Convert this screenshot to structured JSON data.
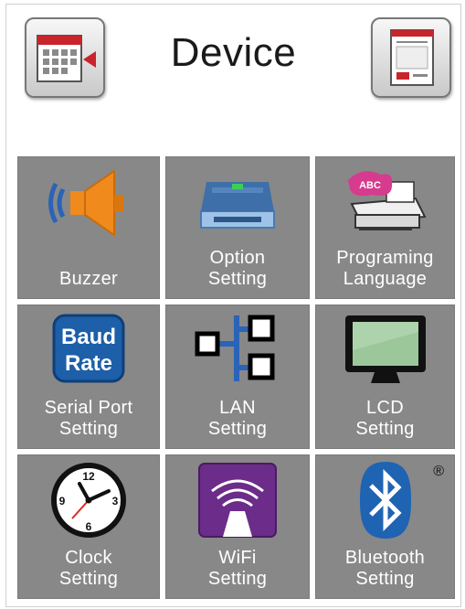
{
  "header": {
    "title": "Device",
    "back_icon": "calendar-back-icon",
    "next_icon": "page-forward-icon"
  },
  "tiles": [
    {
      "icon": "buzzer-icon",
      "line1": "Buzzer",
      "line2": ""
    },
    {
      "icon": "option-device-icon",
      "line1": "Option",
      "line2": "Setting"
    },
    {
      "icon": "printer-abc-icon",
      "line1": "Programing",
      "line2": "Language"
    },
    {
      "icon": "baud-rate-icon",
      "icon_text1": "Baud",
      "icon_text2": "Rate",
      "line1": "Serial Port",
      "line2": "Setting"
    },
    {
      "icon": "network-icon",
      "line1": "LAN",
      "line2": "Setting"
    },
    {
      "icon": "monitor-icon",
      "line1": "LCD",
      "line2": "Setting"
    },
    {
      "icon": "clock-icon",
      "clock_numbers": [
        "12",
        "3",
        "6",
        "9"
      ],
      "line1": "Clock",
      "line2": "Setting"
    },
    {
      "icon": "wifi-icon",
      "line1": "WiFi",
      "line2": "Setting"
    },
    {
      "icon": "bluetooth-icon",
      "mark": "®",
      "line1": "Bluetooth",
      "line2": "Setting"
    }
  ],
  "colors": {
    "tile": "#888888",
    "buzzer": "#f08a1c",
    "baud_blue": "#1d5fa8",
    "wifi_purple": "#6b2c8a",
    "bluetooth_blue": "#1f63b3",
    "calendar_red": "#c8242b"
  }
}
